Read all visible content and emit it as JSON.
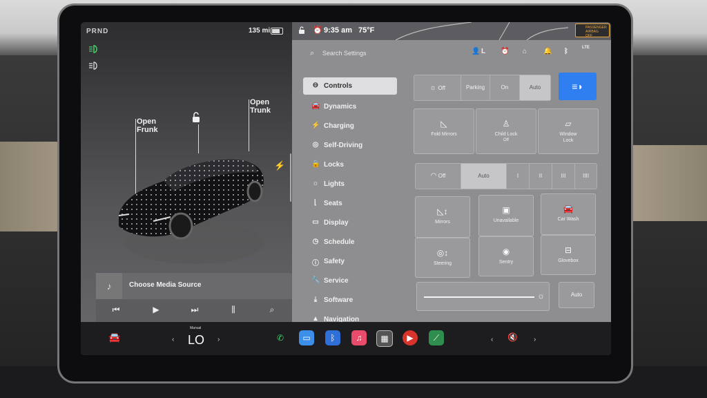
{
  "car_panel": {
    "gear": "PRND",
    "range": "135 mi",
    "frunk_label_1": "Open",
    "frunk_label_2": "Frunk",
    "trunk_label_1": "Open",
    "trunk_label_2": "Trunk",
    "media_label": "Choose Media Source"
  },
  "status": {
    "time": "9:35 am",
    "temperature": "75°F",
    "airbag_1": "PASSENGER",
    "airbag_2": "AIRBAG",
    "airbag_3": "OFF",
    "profile_initial": "L",
    "lte": "LTE"
  },
  "search": {
    "placeholder": "Search Settings"
  },
  "menu": {
    "items": [
      {
        "label": "Controls",
        "icon": "toggle-icon"
      },
      {
        "label": "Dynamics",
        "icon": "car-icon"
      },
      {
        "label": "Charging",
        "icon": "bolt-icon"
      },
      {
        "label": "Self-Driving",
        "icon": "steering-wheel-icon"
      },
      {
        "label": "Locks",
        "icon": "lock-icon"
      },
      {
        "label": "Lights",
        "icon": "sun-icon"
      },
      {
        "label": "Seats",
        "icon": "seat-icon"
      },
      {
        "label": "Display",
        "icon": "display-icon"
      },
      {
        "label": "Schedule",
        "icon": "clock-icon"
      },
      {
        "label": "Safety",
        "icon": "info-icon"
      },
      {
        "label": "Service",
        "icon": "wrench-icon"
      },
      {
        "label": "Software",
        "icon": "download-icon"
      },
      {
        "label": "Navigation",
        "icon": "navigation-icon"
      }
    ]
  },
  "controls": {
    "lights": {
      "off": "Off",
      "parking": "Parking",
      "on": "On",
      "auto": "Auto",
      "selected": "Auto"
    },
    "fold_mirrors": "Fold Mirrors",
    "child_lock": "Child Lock",
    "child_lock_state": "Off",
    "window_lock_1": "Window",
    "window_lock_2": "Lock",
    "wipers": {
      "off": "Off",
      "auto": "Auto",
      "s1": "I",
      "s2": "II",
      "s3": "III",
      "s4": "IIII",
      "selected": "Auto"
    },
    "mirrors": "Mirrors",
    "unavailable": "Unavailable",
    "car_wash": "Car Wash",
    "steering": "Steering",
    "sentry": "Sentry",
    "glovebox": "Glovebox",
    "brightness_auto": "Auto"
  },
  "dock": {
    "climate_mode": "Manual",
    "climate_temp": "LO"
  },
  "colors": {
    "accent_blue": "#2f7ff0",
    "airbag_orange": "#e8a53a",
    "alarm_orange": "#f2a23b"
  }
}
